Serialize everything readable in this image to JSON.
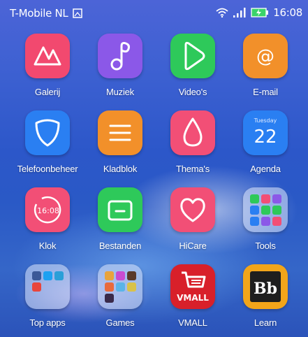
{
  "status_bar": {
    "carrier": "T-Mobile  NL",
    "time": "16:08",
    "icons": [
      "screenshot-notification-icon",
      "wifi-icon",
      "signal-icon",
      "battery-charging-icon"
    ]
  },
  "apps": {
    "galerij": {
      "label": "Galerij",
      "icon": "gallery-icon",
      "color": "#f2496f"
    },
    "muziek": {
      "label": "Muziek",
      "icon": "music-note-icon",
      "color": "#8b58e8"
    },
    "videos": {
      "label": "Video's",
      "icon": "play-icon",
      "color": "#2ec95a"
    },
    "email": {
      "label": "E-mail",
      "icon": "at-sign-icon",
      "color": "#f2902a"
    },
    "telefoonbeheer": {
      "label": "Telefoonbeheer",
      "icon": "shield-icon",
      "color": "#2a7ff2"
    },
    "kladblok": {
      "label": "Kladblok",
      "icon": "notepad-icon",
      "color": "#f2902a"
    },
    "themas": {
      "label": "Thema's",
      "icon": "drop-icon",
      "color": "#f24f76"
    },
    "agenda": {
      "label": "Agenda",
      "icon": "calendar-icon",
      "color": "#2a7ff2",
      "weekday": "Tuesday",
      "day": "22"
    },
    "klok": {
      "label": "Klok",
      "icon": "clock-icon",
      "color": "#f24f76",
      "time": "16:08"
    },
    "bestanden": {
      "label": "Bestanden",
      "icon": "folder-icon",
      "color": "#2ec95a"
    },
    "hicare": {
      "label": "HiCare",
      "icon": "heart-icon",
      "color": "#f24f76"
    },
    "tools": {
      "label": "Tools",
      "icon": "folder-tools-icon"
    },
    "top_apps": {
      "label": "Top apps",
      "icon": "folder-top-apps-icon"
    },
    "games": {
      "label": "Games",
      "icon": "folder-games-icon"
    },
    "vmall": {
      "label": "VMALL",
      "icon": "vmall-cart-icon",
      "color": "#d8202a",
      "logo_text": "VMALL"
    },
    "learn": {
      "label": "Learn",
      "icon": "blackboard-icon",
      "color": "#1e1e1e",
      "logo_text": "Bb"
    }
  }
}
